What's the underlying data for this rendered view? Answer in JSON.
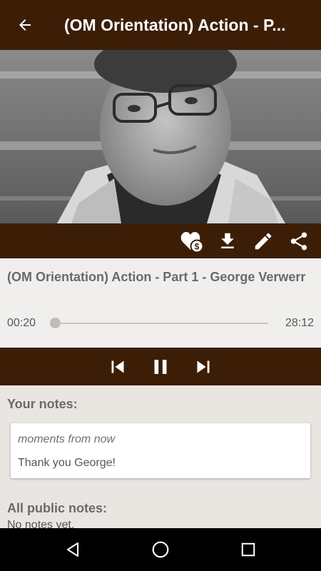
{
  "header": {
    "title": "(OM Orientation) Action - P...",
    "back_icon": "arrow-left-icon"
  },
  "photo": {
    "description_icon": "portrait-image"
  },
  "actions": [
    {
      "name": "donate-heart-icon"
    },
    {
      "name": "download-icon"
    },
    {
      "name": "edit-pencil-icon"
    },
    {
      "name": "share-icon"
    }
  ],
  "track": {
    "title": "(OM Orientation) Action - Part 1 - George Verwerr",
    "current_time": "00:20",
    "total_time": "28:12",
    "progress": 0.012
  },
  "player": {
    "previous_icon": "skip-previous-icon",
    "pause_icon": "pause-icon",
    "next_icon": "skip-next-icon"
  },
  "notes": {
    "your_heading": "Your notes:",
    "items": [
      {
        "time": "moments from now",
        "text": "Thank you George!"
      }
    ],
    "public_heading": "All public notes:",
    "public_empty": "No notes yet."
  },
  "colors": {
    "brand_brown": "#3c1e07",
    "background": "#e9e6e2"
  }
}
